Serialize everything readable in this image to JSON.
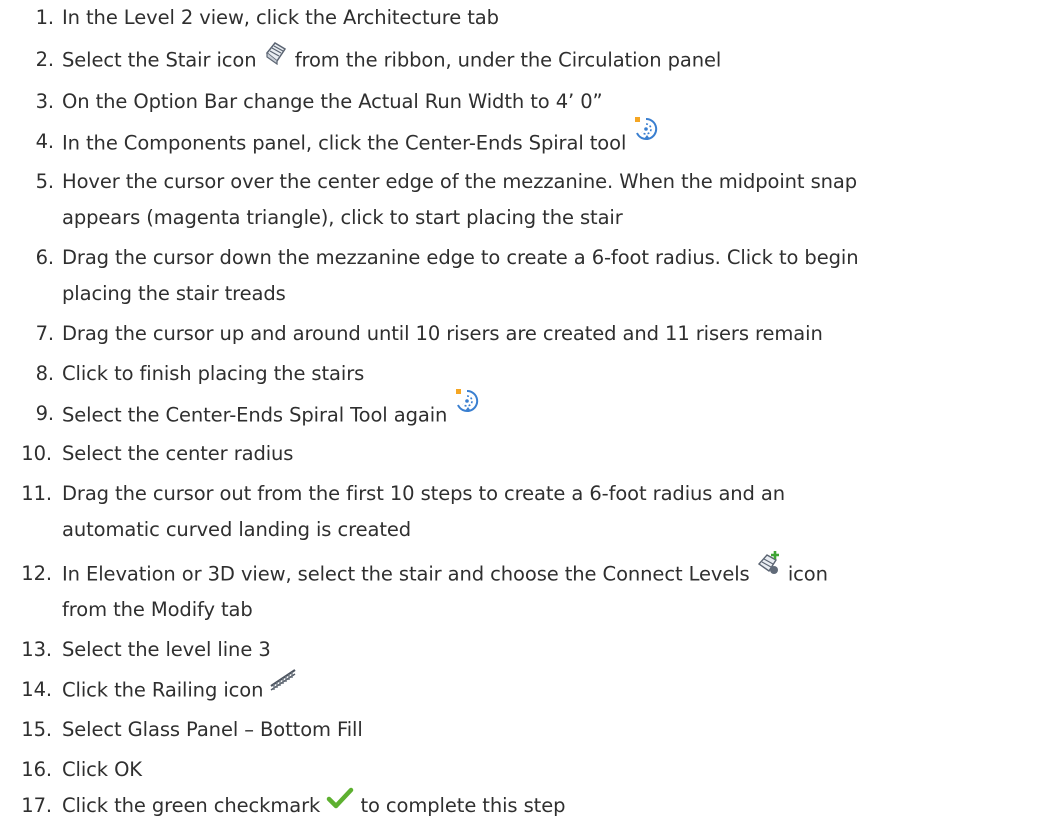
{
  "steps": [
    {
      "num": "1.",
      "parts": [
        "In the Level 2 view, click the Architecture tab"
      ]
    },
    {
      "num": "2.",
      "parts": [
        "Select the Stair icon",
        "from the ribbon, under the Circulation panel"
      ],
      "icon": "stair-icon"
    },
    {
      "num": "3.",
      "parts": [
        "On the Option Bar change the Actual Run Width to 4’ 0”"
      ]
    },
    {
      "num": "4.",
      "parts": [
        "In the Components panel, click the Center-Ends Spiral tool"
      ],
      "icon": "center-ends-spiral-icon"
    },
    {
      "num": "5.",
      "lines": [
        "Hover the cursor over the center edge of the mezzanine. When the midpoint snap",
        "appears (magenta triangle), click to start placing the stair"
      ]
    },
    {
      "num": "6.",
      "lines": [
        "Drag the cursor down the mezzanine edge to create a 6-foot radius. Click to begin",
        "placing the stair treads"
      ]
    },
    {
      "num": "7.",
      "parts": [
        "Drag the cursor up and around until 10 risers are created and 11 risers remain"
      ]
    },
    {
      "num": "8.",
      "parts": [
        "Click to finish placing the stairs"
      ]
    },
    {
      "num": "9.",
      "parts": [
        "Select the Center-Ends Spiral Tool again"
      ],
      "icon": "center-ends-spiral-icon"
    },
    {
      "num": "10.",
      "parts": [
        "Select the center radius"
      ]
    },
    {
      "num": "11.",
      "lines": [
        "Drag the cursor out from the first 10 steps to create a 6-foot radius and an",
        "automatic curved landing is created"
      ]
    },
    {
      "num": "12.",
      "lines": [
        "In Elevation or 3D view, select the stair and choose the Connect Levels",
        "from the Modify tab"
      ],
      "line1_suffix": "icon",
      "icon": "connect-levels-icon"
    },
    {
      "num": "13.",
      "parts": [
        "Select the level line 3"
      ]
    },
    {
      "num": "14.",
      "parts": [
        "Click the Railing icon"
      ],
      "icon": "railing-icon"
    },
    {
      "num": "15.",
      "parts": [
        "Select Glass Panel – Bottom Fill"
      ]
    },
    {
      "num": "16.",
      "parts": [
        "Click OK"
      ]
    },
    {
      "num": "17.",
      "parts": [
        "Click the green checkmark",
        "to complete this step"
      ],
      "icon": "green-checkmark-icon"
    }
  ],
  "colors": {
    "text": "#2f2f2f",
    "checkmark": "#5db030",
    "spiral": "#3a7fd0"
  }
}
